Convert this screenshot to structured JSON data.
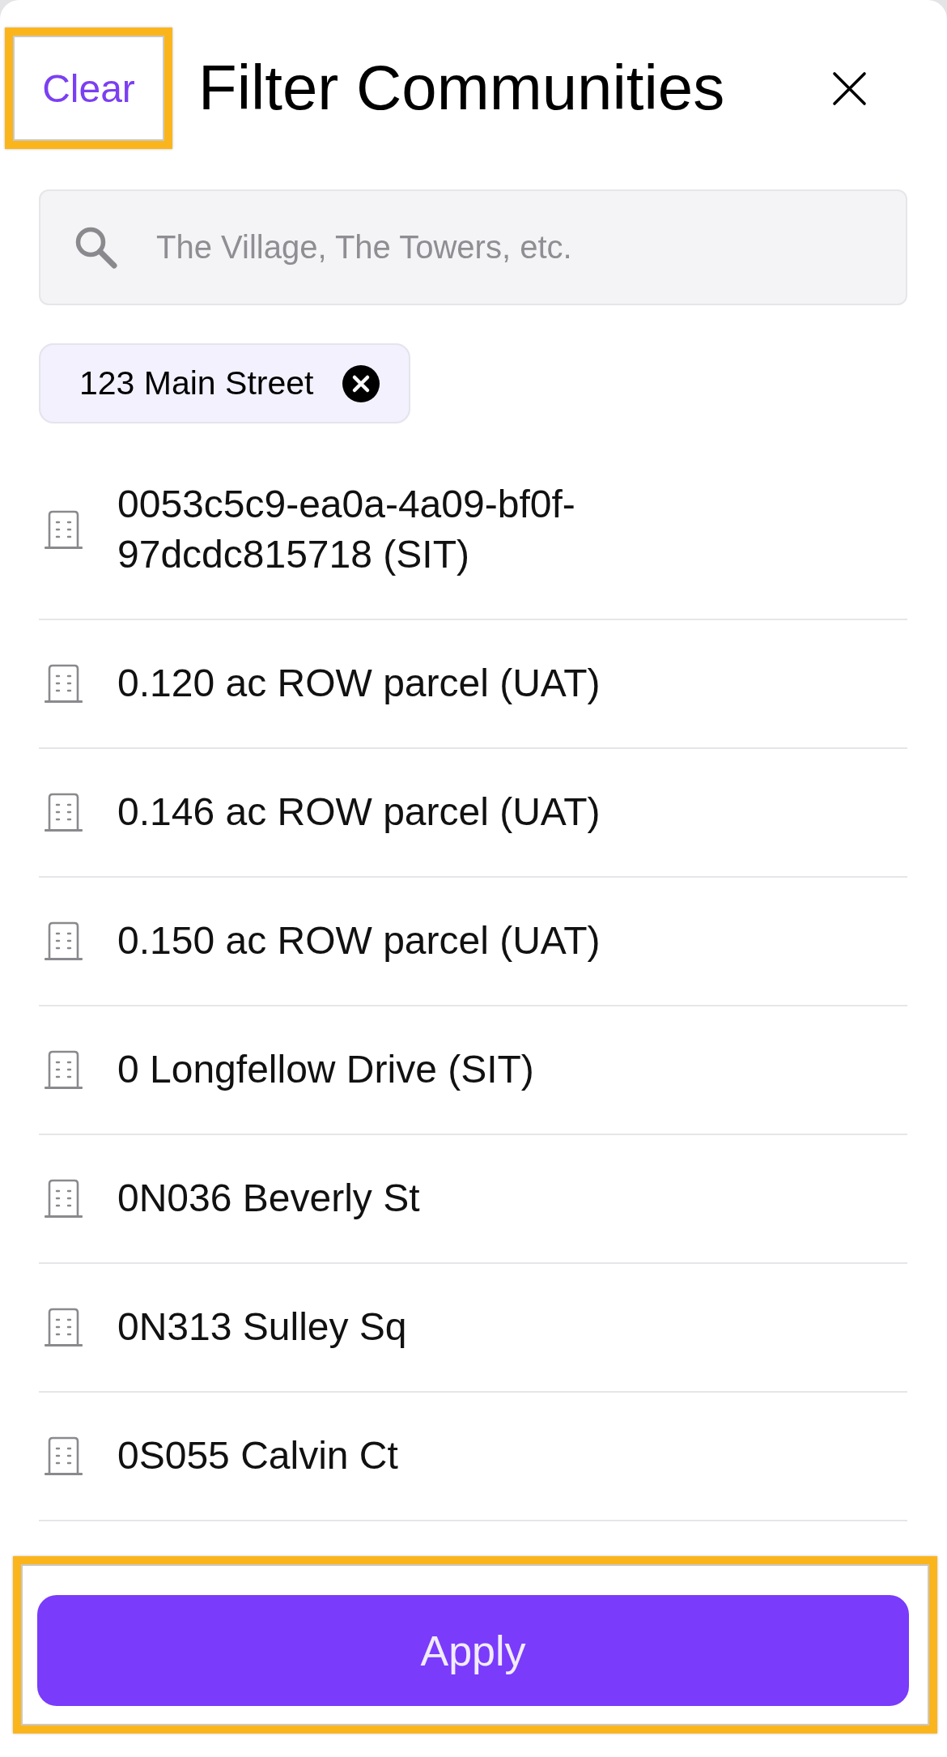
{
  "header": {
    "clear_button": {
      "label": "Clear",
      "highlighted": true
    },
    "title": "Filter Communities"
  },
  "search": {
    "placeholder": "The Village, The Towers, etc."
  },
  "selected_filters": [
    {
      "label": "123 Main Street"
    }
  ],
  "communities": [
    {
      "name": "0053c5c9-ea0a-4a09-bf0f-97dcdc815718 (SIT)"
    },
    {
      "name": "0.120 ac ROW parcel (UAT)"
    },
    {
      "name": "0.146 ac ROW parcel (UAT)"
    },
    {
      "name": "0.150 ac ROW parcel (UAT)"
    },
    {
      "name": "0 Longfellow Drive (SIT)"
    },
    {
      "name": "0N036 Beverly St"
    },
    {
      "name": "0N313 Sulley Sq"
    },
    {
      "name": "0S055 Calvin Ct"
    }
  ],
  "apply_button": {
    "label": "Apply",
    "highlighted": true
  }
}
